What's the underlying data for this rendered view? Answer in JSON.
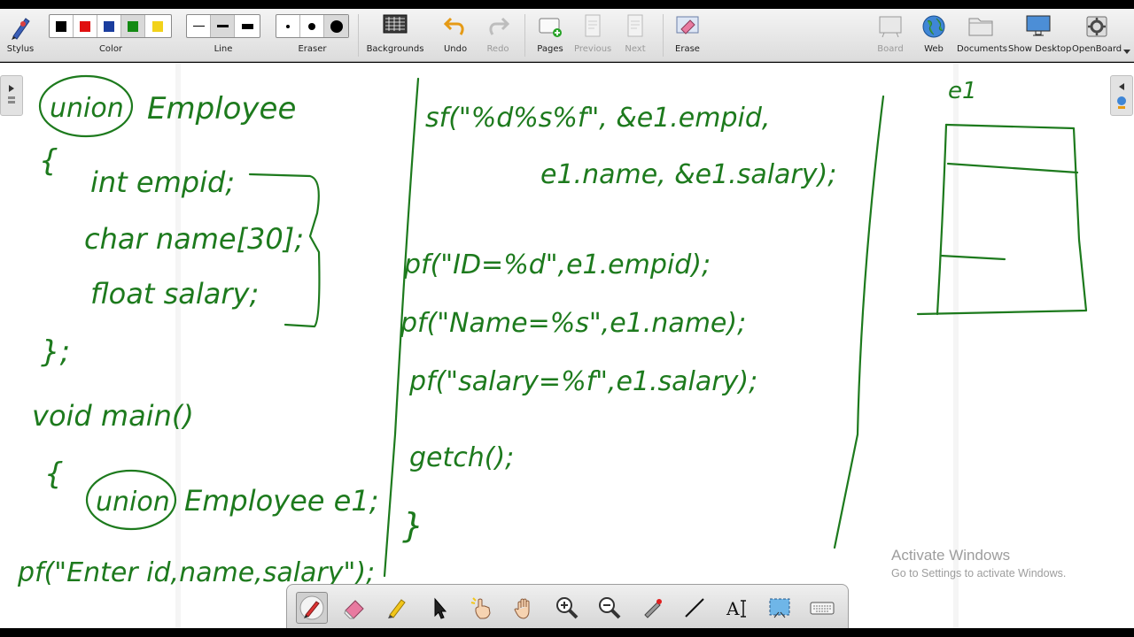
{
  "toolbar": {
    "stylus": "Stylus",
    "color": "Color",
    "line": "Line",
    "eraser": "Eraser",
    "backgrounds": "Backgrounds",
    "undo": "Undo",
    "redo": "Redo",
    "pages": "Pages",
    "previous": "Previous",
    "next": "Next",
    "erase": "Erase",
    "board": "Board",
    "web": "Web",
    "documents": "Documents",
    "show_desktop": "Show Desktop",
    "openboard": "OpenBoard",
    "colors": [
      "#000000",
      "#e01010",
      "#1a3d9e",
      "#138a13",
      "#f2d21a"
    ]
  },
  "board": {
    "ink_color": "#1d7a1d",
    "lines": [
      "union Employee",
      "{",
      "int empid;",
      "char name[30];",
      "float salary;",
      "};",
      "void main()",
      "{",
      "union Employee e1;",
      "pf(\"Enter id,name,salary\");",
      "sf(\"%d%s%f\", &e1.empid,",
      "e1.name, &e1.salary);",
      "pf(\"ID=%d\",e1.empid);",
      "pf(\"Name=%s\",e1.name);",
      "pf(\"salary=%f\",e1.salary);",
      "getch();",
      "}",
      "e1"
    ]
  },
  "watermark": {
    "title": "Activate Windows",
    "subtitle": "Go to Settings to activate Windows."
  }
}
